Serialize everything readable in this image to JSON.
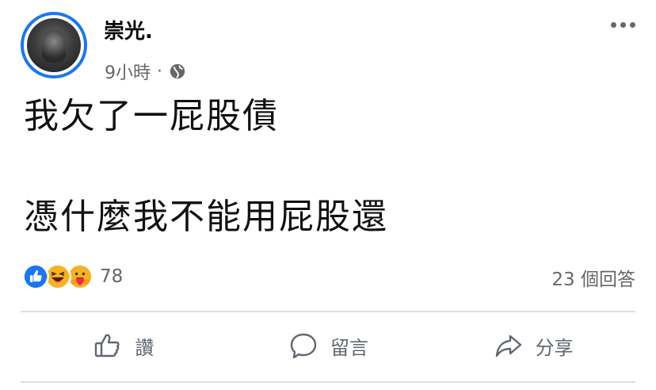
{
  "post": {
    "author": "崇光.",
    "time": "9小時",
    "separator": "·",
    "privacy_icon": "globe-icon",
    "more_icon": "more-options-icon",
    "line1": "我欠了一屁股債",
    "line2": "憑什麼我不能用屁股還"
  },
  "reactions": {
    "icons": [
      "like-icon",
      "haha-icon",
      "care-icon"
    ],
    "count": "78",
    "comments": "23 個回答"
  },
  "actions": {
    "like": "讚",
    "comment": "留言",
    "share": "分享"
  },
  "colors": {
    "accent": "#1877f2",
    "secondary_text": "#65676b",
    "divider": "#dadde1"
  }
}
